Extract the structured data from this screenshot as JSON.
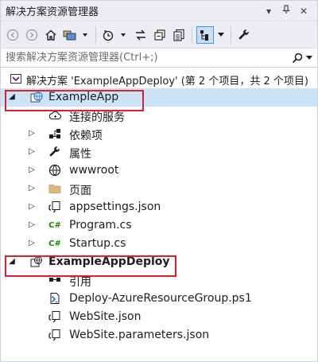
{
  "window": {
    "title": "解决方案资源管理器",
    "pin_glyph": "▾",
    "autohide_glyph": "ᛘ",
    "close_glyph": "✕"
  },
  "search": {
    "placeholder": "搜索解决方案资源管理器(Ctrl+;)"
  },
  "tree": {
    "solution": "解决方案 'ExampleAppDeploy' (第 2 个项目，共 2 个项目)",
    "items": [
      {
        "label": "ExampleApp"
      },
      {
        "label": "连接的服务"
      },
      {
        "label": "依赖项"
      },
      {
        "label": "属性"
      },
      {
        "label": "wwwroot"
      },
      {
        "label": "页面"
      },
      {
        "label": "appsettings.json"
      },
      {
        "label": "Program.cs"
      },
      {
        "label": "Startup.cs"
      },
      {
        "label": "ExampleAppDeploy"
      },
      {
        "label": "引用"
      },
      {
        "label": "Deploy-AzureResourceGroup.ps1"
      },
      {
        "label": "WebSite.json"
      },
      {
        "label": "WebSite.parameters.json"
      }
    ]
  },
  "colors": {
    "highlight": "#e0202c",
    "selected": "#cce4f7",
    "accent": "#007acc"
  }
}
